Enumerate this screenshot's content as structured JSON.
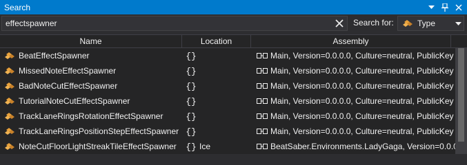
{
  "window": {
    "title": "Search"
  },
  "search": {
    "value": "effectspawner",
    "search_for_label": "Search for:",
    "type_value": "Type"
  },
  "columns": {
    "name": "Name",
    "location": "Location",
    "assembly": "Assembly"
  },
  "rows": [
    {
      "name": "BeatEffectSpawner",
      "location": "",
      "assembly": "Main, Version=0.0.0.0, Culture=neutral, PublicKey"
    },
    {
      "name": "MissedNoteEffectSpawner",
      "location": "",
      "assembly": "Main, Version=0.0.0.0, Culture=neutral, PublicKey"
    },
    {
      "name": "BadNoteCutEffectSpawner",
      "location": "",
      "assembly": "Main, Version=0.0.0.0, Culture=neutral, PublicKey"
    },
    {
      "name": "TutorialNoteCutEffectSpawner",
      "location": "",
      "assembly": "Main, Version=0.0.0.0, Culture=neutral, PublicKey"
    },
    {
      "name": "TrackLaneRingsRotationEffectSpawner",
      "location": "",
      "assembly": "Main, Version=0.0.0.0, Culture=neutral, PublicKey"
    },
    {
      "name": "TrackLaneRingsPositionStepEffectSpawner",
      "location": "",
      "assembly": "Main, Version=0.0.0.0, Culture=neutral, PublicKey"
    },
    {
      "name": "NoteCutFloorLightStreakTileEffectSpawner",
      "location": "Ice",
      "assembly": "BeatSaber.Environments.LadyGaga, Version=0.0.0"
    }
  ],
  "icons": {
    "class": "class-icon",
    "namespace": "namespace-icon",
    "assembly": "assembly-icon"
  },
  "colors": {
    "accent": "#007acc",
    "class_icon": "#e8a13b"
  }
}
